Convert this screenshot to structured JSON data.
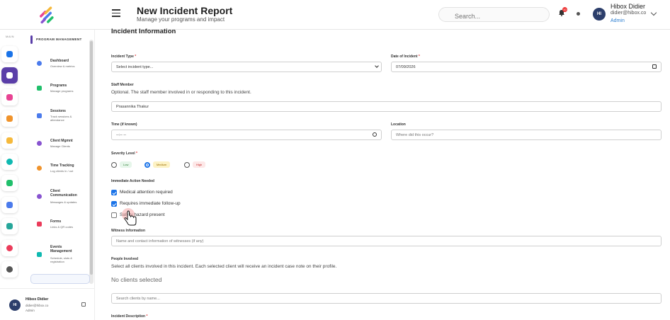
{
  "header": {
    "title": "New Incident Report",
    "subtitle": "Manage your programs and impact",
    "search_placeholder": "Search...",
    "notification_count": "10",
    "user": {
      "initials": "HI",
      "name": "Hibox Didier",
      "email": "didier@hibox.co",
      "role": "Admin"
    }
  },
  "rail": {
    "label": "MAIN",
    "items": [
      {
        "name": "home-icon",
        "color": "#1a73e8"
      },
      {
        "name": "programs-icon",
        "color": "#ffffff",
        "active": true
      },
      {
        "name": "sparkle-icon",
        "color": "#e84393"
      },
      {
        "name": "book-icon",
        "color": "#f0932b"
      },
      {
        "name": "layers-icon",
        "color": "#f6b93b"
      },
      {
        "name": "circle-icon",
        "color": "#0fb9b1"
      },
      {
        "name": "network-icon",
        "color": "#20bf6b"
      },
      {
        "name": "document-icon",
        "color": "#4b7bec"
      },
      {
        "name": "group-icon",
        "color": "#26a69a"
      },
      {
        "name": "pie-icon",
        "color": "#eb3b5a"
      },
      {
        "name": "settings-icon",
        "color": "#555555"
      }
    ]
  },
  "sidebar": {
    "title": "PROGRAM MANAGEMENT",
    "items": [
      {
        "label": "Dashboard",
        "desc": "Overview & metrics",
        "color": "#4b7bec"
      },
      {
        "label": "Programs",
        "desc": "Manage programs",
        "color": "#20bf6b"
      },
      {
        "label": "Sessions",
        "desc": "Track sessions & attendance",
        "color": "#4b7bec"
      },
      {
        "label": "Client Mgmnt",
        "desc": "Manage Clients",
        "color": "#8854d0"
      },
      {
        "label": "Time Tracking",
        "desc": "Log clients in / out",
        "color": "#f0932b"
      },
      {
        "label": "Client Communication",
        "desc": "Messages & updates",
        "color": "#8854d0"
      },
      {
        "label": "Forms",
        "desc": "Links & QR codes",
        "color": "#eb3b5a"
      },
      {
        "label": "Events Management",
        "desc": "Schedule, slots & registration",
        "color": "#0fb9b1"
      }
    ]
  },
  "footer_user": {
    "initials": "HI",
    "name": "Hibox Didier",
    "email": "didier@hibox.co",
    "role": "Admin"
  },
  "form": {
    "section_title": "Incident Information",
    "incident_type": {
      "label": "Incident Type",
      "value": "Select incident type..."
    },
    "date": {
      "label": "Date of Incident",
      "value": "07/09/2026"
    },
    "staff": {
      "label": "Staff Member",
      "help": "Optional. The staff member involved in or responding to this incident.",
      "value": "Prasannika Thakur"
    },
    "time": {
      "label": "Time (if known)",
      "value": "--:-- --"
    },
    "location": {
      "label": "Location",
      "placeholder": "Where did this occur?"
    },
    "severity": {
      "label": "Severity Level",
      "options": [
        {
          "label": "Low",
          "bg": "#e6f6ea",
          "fg": "#2e7d32"
        },
        {
          "label": "Medium",
          "bg": "#fdf2c4",
          "fg": "#9a6b00"
        },
        {
          "label": "High",
          "bg": "#fde8e8",
          "fg": "#c62828"
        }
      ],
      "selected": "Medium"
    },
    "actions": {
      "label": "Immediate Action Needed",
      "items": [
        {
          "label": "Medical attention required",
          "checked": true
        },
        {
          "label": "Requires immediate follow-up",
          "checked": true
        },
        {
          "label": "Safety hazard present",
          "checked": false
        }
      ]
    },
    "witness": {
      "label": "Witness Information",
      "placeholder": "Name and contact information of witnesses (if any)"
    },
    "people": {
      "label": "People Involved",
      "help": "Select all clients involved in this incident. Each selected client will receive an incident case note on their profile.",
      "empty": "No clients selected",
      "search_placeholder": "Search clients by name..."
    },
    "description": {
      "label": "Incident Description"
    }
  },
  "required_mark": "*",
  "colors": {
    "accent": "#5a3ea8",
    "primary": "#1a73e8"
  }
}
